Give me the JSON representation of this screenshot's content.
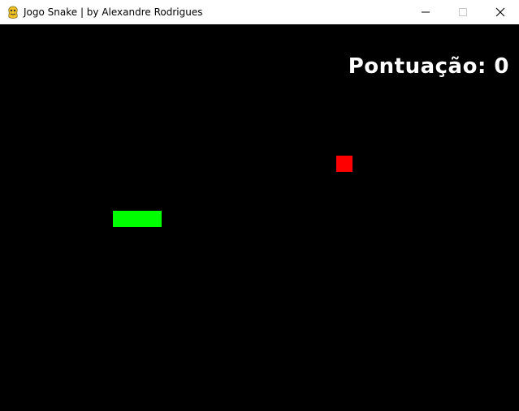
{
  "window": {
    "title": "Jogo Snake | by Alexandre Rodrigues",
    "app_icon": "pygame-snake-icon",
    "controls": [
      "minimize-icon",
      "maximize-icon",
      "close-icon"
    ]
  },
  "game": {
    "score_text": "Pontuação: 0",
    "grid_cell": "20",
    "background_color": "#000000",
    "snake_color": "#00ff00",
    "food_color": "#ff0000",
    "score_color": "#ffffff",
    "snake_segment_count": 3,
    "direction": "right"
  }
}
